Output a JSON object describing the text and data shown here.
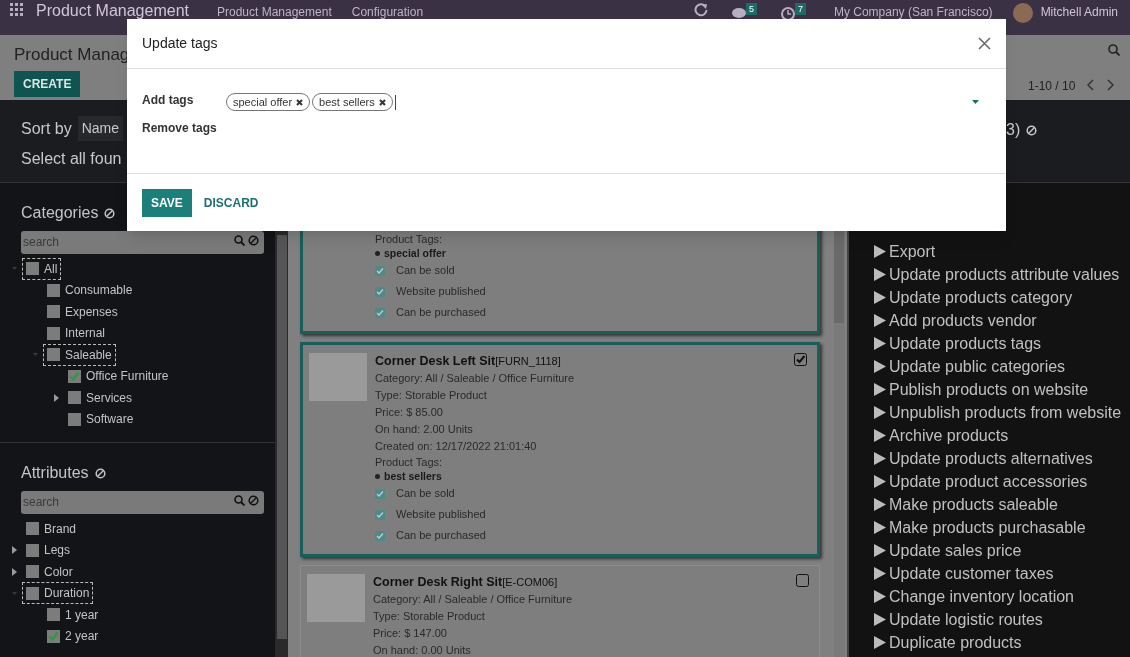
{
  "nav": {
    "app_name": "Product Management",
    "menus": [
      "Product Management",
      "Configuration"
    ],
    "chat_count": "5",
    "activity_count": "7",
    "company": "My Company (San Francisco)",
    "user": "Mitchell Admin"
  },
  "control_panel": {
    "title": "Product Manag",
    "create_label": "CREATE",
    "pager": "1-10 / 10"
  },
  "toolbar": {
    "sort_label": "Sort by",
    "sort_field": "Name",
    "select_all": "Select all foun",
    "count_fragment": "3)"
  },
  "categories": {
    "title": "Categories",
    "search_placeholder": "search",
    "items": [
      {
        "label": "All",
        "checked": false,
        "focused": true,
        "expanded": true,
        "children": [
          {
            "label": "Consumable",
            "checked": false,
            "focused": false
          },
          {
            "label": "Expenses",
            "checked": false,
            "focused": false
          },
          {
            "label": "Internal",
            "checked": false,
            "focused": false
          },
          {
            "label": "Saleable",
            "checked": false,
            "focused": true,
            "expanded": true,
            "children": [
              {
                "label": "Office Furniture",
                "checked": true,
                "focused": false
              },
              {
                "label": "Services",
                "checked": false,
                "focused": false,
                "expanded": false
              },
              {
                "label": "Software",
                "checked": false,
                "focused": false
              }
            ]
          }
        ]
      }
    ]
  },
  "attributes": {
    "title": "Attributes",
    "search_placeholder": "search",
    "items": [
      {
        "label": "Brand",
        "checked": false,
        "focused": false
      },
      {
        "label": "Legs",
        "checked": false,
        "focused": false,
        "expanded": false
      },
      {
        "label": "Color",
        "checked": false,
        "focused": false,
        "expanded": false
      },
      {
        "label": "Duration",
        "checked": false,
        "focused": true,
        "expanded": true,
        "children": [
          {
            "label": "1 year",
            "checked": false,
            "focused": false
          },
          {
            "label": "2 year",
            "checked": true,
            "focused": false
          }
        ]
      }
    ]
  },
  "products": [
    {
      "selected": true,
      "tags_label": "Product Tags:",
      "tags": [
        "special offer"
      ],
      "flags": [
        {
          "label": "Can be sold",
          "checked": true
        },
        {
          "label": "Website published",
          "checked": true
        },
        {
          "label": "Can be purchased",
          "checked": true
        }
      ]
    },
    {
      "selected": true,
      "name": "Corner Desk Left Sit",
      "code": "[FURN_1118]",
      "lines": [
        "Category: All / Saleable / Office Furniture",
        "Type: Storable Product",
        "Price: $ 85.00",
        "On hand: 2.00 Units",
        "Created on: 12/17/2022 21:01:40"
      ],
      "tags_label": "Product Tags:",
      "tags": [
        "best sellers"
      ],
      "flags": [
        {
          "label": "Can be sold",
          "checked": true
        },
        {
          "label": "Website published",
          "checked": true
        },
        {
          "label": "Can be purchased",
          "checked": true
        }
      ]
    },
    {
      "selected": false,
      "name": "Corner Desk Right Sit",
      "code": "[E-COM06]",
      "lines": [
        "Category: All / Saleable / Office Furniture",
        "Type: Storable Product",
        "Price: $ 147.00",
        "On hand: 0.00 Units"
      ]
    }
  ],
  "actions": [
    "Export",
    "Update products attribute values",
    "Update products category",
    "Add products vendor",
    "Update products tags",
    "Update public categories",
    "Publish products on website",
    "Unpublish products from website",
    "Archive products",
    "Update products alternatives",
    "Update product accessories",
    "Make products saleable",
    "Make products purchasable",
    "Update sales price",
    "Update customer taxes",
    "Change inventory location",
    "Update logistic routes",
    "Duplicate products"
  ],
  "dialog": {
    "title": "Update tags",
    "add_label": "Add tags",
    "add_tags": [
      "special offer",
      "best sellers"
    ],
    "remove_label": "Remove tags",
    "save_label": "SAVE",
    "discard_label": "DISCARD"
  }
}
